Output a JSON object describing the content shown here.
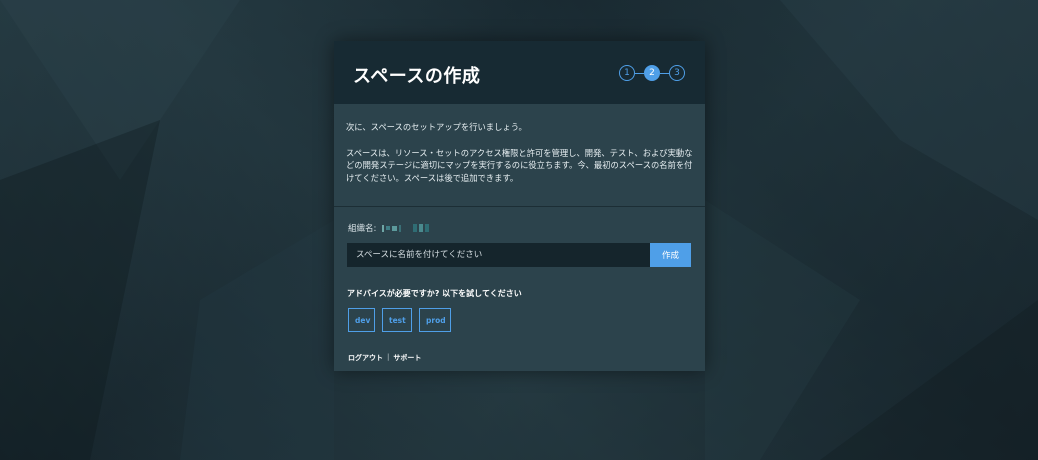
{
  "dialog": {
    "title": "スペースの作成",
    "steps": [
      "1",
      "2",
      "3"
    ],
    "current_step": 2,
    "intro_line1": "次に、スペースのセットアップを行いましょう。",
    "intro_line2": "スペースは、リソース・セットのアクセス権限と許可を管理し、開発、テスト、および実動などの開発ステージに適切にマップを実行するのに役立ちます。今、最初のスペースの名前を付けてください。スペースは後で追加できます。"
  },
  "org": {
    "label": "組織名:"
  },
  "form": {
    "placeholder": "スペースに名前を付けてください",
    "create_label": "作成"
  },
  "advice": {
    "text": "アドバイスが必要ですか? 以下を試してください",
    "suggestions": [
      "dev",
      "test",
      "prod"
    ]
  },
  "footer": {
    "logout": "ログアウト",
    "separator": "|",
    "support": "サポート"
  },
  "colors": {
    "accent": "#4f9fe8",
    "header_bg": "#172a33",
    "dialog_bg": "#2c434c",
    "input_bg": "#15252c"
  }
}
